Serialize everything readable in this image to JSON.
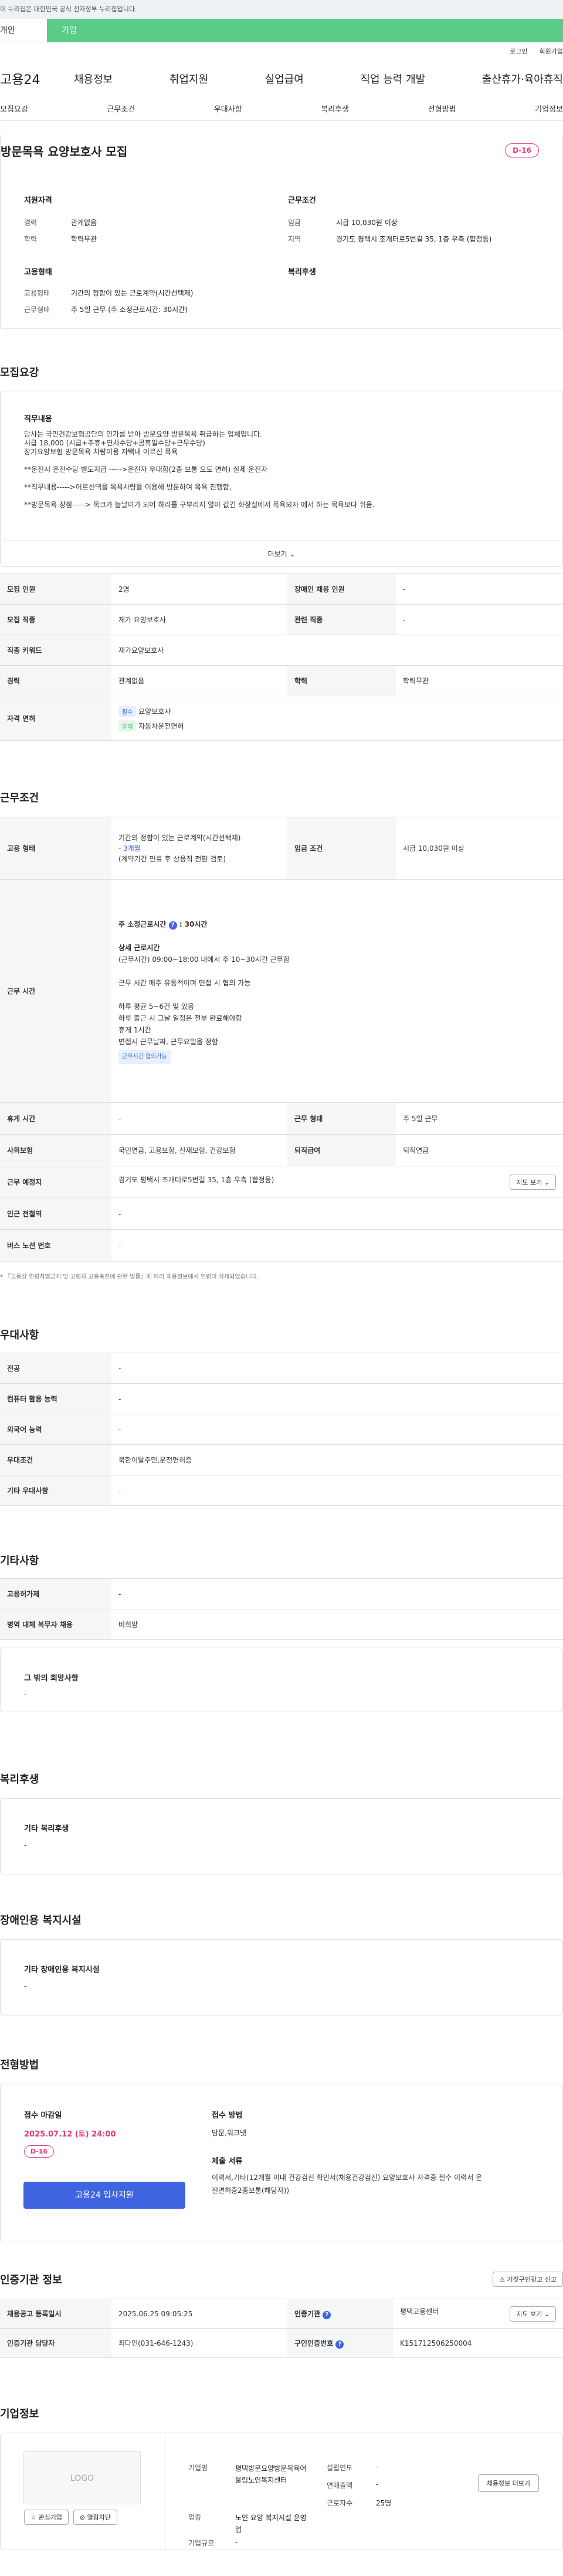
{
  "topbar": {
    "notice": "이 누리집은 대한민국 공식 전자정부 누리집입니다."
  },
  "tabs": {
    "individual": "개인",
    "company": "기업"
  },
  "util": {
    "login": "로그인",
    "join": "회원가입"
  },
  "gnb": {
    "logo": "고용24",
    "items": [
      "채용정보",
      "취업지원",
      "실업급여",
      "직업 능력 개발",
      "출산휴가·육아휴직"
    ]
  },
  "lnb": {
    "items": [
      "모집요강",
      "근무조건",
      "우대사항",
      "복리후생",
      "전형방법",
      "기업정보"
    ]
  },
  "hero": {
    "title": "방문목욕 요양보호사 모집",
    "dday": "D-16",
    "qual_title": "지원자격",
    "career_label": "경력",
    "career_value": "관계없음",
    "edu_label": "학력",
    "edu_value": "학력무관",
    "cond_title": "근무조건",
    "wage_label": "임금",
    "wage_value": "시급 10,030원 이상",
    "region_label": "지역",
    "region_value": "경기도 평택시 조개터로5번길 35, 1층 우측 (합정동)",
    "emp_title": "고용형태",
    "emp_type_label": "고용형태",
    "emp_type_value": "기간의 정함이 있는 근로계약(시간선택제)",
    "work_type_label": "근무형태",
    "work_type_value": "주 5일 근무 (주 소정근로시간: 30시간)",
    "welfare_title": "복리후생"
  },
  "recruit": {
    "section_title": "모집요강",
    "duty_title": "직무내용",
    "duty_lines": [
      "당사는 국민건강보험공단의 인가를 받아 방문요양 방문목욕 취급하는 업체입니다.",
      "시급 18,000 (시급+주휴+연차수당+공휴일수당+근무수당)",
      "장기요양보험  방문목욕  차량이용 자택내 어르신 목욕",
      "",
      "**운전시 운전수당  별도지급 ----->운전자 우대함(2종 보통 오토 면허) 실제 운전자",
      "",
      "**직무내용----->어르신댁을 목욕차량을 이용해 방문하여 목욕 진행함,",
      "",
      "**방문목욕 장점-----> 목크가 늘날이가 되어 하리를 구부리지 않아 값긴 화장실에서 목욕되자 에서 하는 목욕보다 쉬움."
    ],
    "more": "더보기",
    "rows": [
      {
        "k1": "모집 인원",
        "v1": "2명",
        "k2": "장애인 채용 인원",
        "v2": "-"
      },
      {
        "k1": "모집 직종",
        "v1": "재가 요양보호사",
        "k2": "관련 직종",
        "v2": "-"
      },
      {
        "k1": "직종 키워드",
        "v1": "재가요양보호사",
        "k2": "",
        "v2": ""
      },
      {
        "k1": "경력",
        "v1": "관계없음",
        "k2": "학력",
        "v2": "학력무관"
      }
    ],
    "license_label": "자격 면허",
    "licenses": [
      {
        "badge": "필수",
        "name": "요양보호사"
      },
      {
        "badge": "우대",
        "name": "자동차운전면허"
      }
    ]
  },
  "conditions": {
    "section_title": "근무조건",
    "emp_label": "고용 형태",
    "emp_value": "기간의 정함이 있는 근로계약(시간선택제)",
    "emp_period": "- 3개월",
    "emp_note": "(계약기간 만료 후 상용직 전환 검토)",
    "wage_label": "임금 조건",
    "wage_value": "시급 10,030원 이상",
    "time_label": "근무 시간",
    "weekly": "주 소정근로시간",
    "weekly_hours": "30시간",
    "detail_title": "상세 근로시간",
    "detail_lines": [
      "(근무시간) 09:00~18:00 내에서 주 10~30시간 근무함",
      "",
      "근무 시간 매주 유동적이며 면접 시 협의 가능",
      "",
      "하루 평균 5~6건 및 있음",
      "하루 출근 시 그날 일정은 전부 완료해야함",
      "휴게 1시간",
      "면접시 근무날짜, 근무요일을 정함"
    ],
    "time_badge": "근무시간 협의가능",
    "rows": [
      {
        "k1": "휴게 시간",
        "v1": "-",
        "k2": "근무 형태",
        "v2": "주 5일 근무"
      },
      {
        "k1": "사회보험",
        "v1": "국민연금, 고용보험, 산재보험, 건강보험",
        "k2": "퇴직급여",
        "v2": "퇴직연금"
      }
    ],
    "place_label": "근무 예정지",
    "place_value": "경기도 평택시 조개터로5번길 35, 1층 우측 (합정동)",
    "map_btn": "지도 보기",
    "subway_label": "인근 전철역",
    "subway_value": "-",
    "bus_label": "버스 노선 번호",
    "bus_value": "-",
    "footnote": "* 『고용상 연령차별금지 및 고령자 고용촉진에 관한 법률』에 따라 채용정보에서 연령이 삭제되었습니다."
  },
  "preference": {
    "section_title": "우대사항",
    "rows": [
      {
        "k": "전공",
        "v": "-"
      },
      {
        "k": "컴퓨터 활용 능력",
        "v": "-"
      },
      {
        "k": "외국어 능력",
        "v": "-"
      },
      {
        "k": "우대조건",
        "v": "북한이탈주민,운전면허증"
      },
      {
        "k": "기타 우대사항",
        "v": "-"
      }
    ]
  },
  "etc": {
    "section_title": "기타사항",
    "rows": [
      {
        "k": "고용허가제",
        "v": "-"
      },
      {
        "k": "병역 대체 복무자 채용",
        "v": "비희망"
      }
    ],
    "other_title": "그 밖의 희망사항",
    "other_value": "-"
  },
  "welfare": {
    "section_title": "복리후생",
    "box_title": "기타 복리후생",
    "box_value": "-"
  },
  "disabled": {
    "section_title": "장애인용 복지시설",
    "box_title": "기타 장애인용 복지시설",
    "box_value": "-"
  },
  "selection": {
    "section_title": "전형방법",
    "deadline_label": "접수 마감일",
    "deadline_value": "2025.07.12 (토) 24:00",
    "dday": "D-16",
    "apply_btn": "고용24 입사지원",
    "method_label": "접수 방법",
    "method_value": "방문,워크넷",
    "docs_label": "제출 서류",
    "docs_value1": "이력서,기타(12개월 이내 건강검진 확인서(채용건강검진) 요양보호사 자격증 필수  이력서   운",
    "docs_value2": "전면허증2종보통(해당자))"
  },
  "auth": {
    "section_title": "인증기관 정보",
    "report_btn": "거짓구인광고 신고",
    "rows": [
      {
        "k1": "채용공고 등록일시",
        "v1": "2025.06.25 09:05:25",
        "k2": "인증기관",
        "v2": "평택고용센터",
        "btn": "지도 보기"
      },
      {
        "k1": "인증기관 담당자",
        "v1": "최다인(031-646-1243)",
        "k2": "구인인증번호",
        "v2": "K151712506250004",
        "btn": ""
      }
    ]
  },
  "company": {
    "section_title": "기업정보",
    "logo": "LOGO",
    "fav_btn": "관심기업",
    "block_btn": "열람차단",
    "name_label": "기업명",
    "name_value": "평택방문요양방문목욕어울림노인복지센터",
    "industry_label": "업종",
    "industry_value": "노인 요양 복지시설 운영업",
    "scale_label": "기업규모",
    "scale_value": "-",
    "founded_label": "설립연도",
    "founded_value": "-",
    "sales_label": "연매출액",
    "sales_value": "-",
    "workers_label": "근로자수",
    "workers_value": "25명",
    "detail_btn": "채용정보 더보기"
  }
}
